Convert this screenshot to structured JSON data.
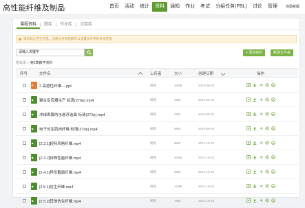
{
  "header": {
    "course_title": "高性能纤维及制品",
    "course_subtitle": "课程门户",
    "nav": [
      "首页",
      "活动",
      "统计",
      "资料",
      "通知",
      "作业",
      "考试",
      "分组任务(PBL)",
      "讨论",
      "管理"
    ],
    "nav_active": "资料",
    "right_label": "体验新版"
  },
  "tabs": [
    "课程资料",
    "题库",
    "作业库",
    "试卷库"
  ],
  "notice": "资料默认学生可见，创建文件夹后即可以设置文件夹的共享范围",
  "search": {
    "placeholder": "请输入关键字"
  },
  "buttons": {
    "add_resource": "+ 添加资料",
    "new_folder": "新建文件夹"
  },
  "breadcrumb": {
    "root": "根目录",
    "sep": ">",
    "current": "第2章教学资料"
  },
  "table": {
    "headers": {
      "index": "序号",
      "name": "文件名",
      "uploader": "上传者",
      "size": "大小",
      "created": "创建日期",
      "ops": "操作"
    },
    "rows": [
      {
        "type": "ppt",
        "name": "2 高感性纤维---.ppt",
        "uploader": "杨恂",
        "size": "24MB",
        "date": "2019-09-05"
      },
      {
        "type": "mp4",
        "name": "聚合反应器生产 标清(270p).mp4",
        "uploader": "杨恂",
        "size": "4MB",
        "date": "2019-09-05"
      },
      {
        "type": "mp4",
        "name": "冲绿表膜的水悬浮选面 标清(270p).mp4",
        "uploader": "杨恂",
        "size": "2MB",
        "date": "2019-09-05"
      },
      {
        "type": "mp4",
        "name": "电子仿生肌肉纤维 标清(270p).mp4",
        "uploader": "杨恂",
        "size": "5MB",
        "date": "2019-09-05"
      },
      {
        "type": "mp4",
        "name": "[2.3.1]超特风格纤维.mp4",
        "uploader": "杨恂",
        "size": "9MB",
        "date": "2021-10-25"
      },
      {
        "type": "mp4",
        "name": "[2.3.2]特殊性能纤维.mp4",
        "uploader": "杨恂",
        "size": "20MB",
        "date": "2021-10-25"
      },
      {
        "type": "mp4",
        "name": "[2.4.1]异形截面纤维.mp4",
        "uploader": "杨恂",
        "size": "8MB",
        "date": "2021-10-25"
      },
      {
        "type": "mp4",
        "name": "[2.5.1]仿生纤维.mp4",
        "uploader": "杨恂",
        "size": "11MB",
        "date": "2021-10-25"
      },
      {
        "type": "mp4",
        "name": "[2.5.2]其他仿生纤维.mp4",
        "uploader": "杨恂",
        "size": "7MB",
        "date": "2021-10-25"
      }
    ]
  },
  "colors": {
    "accent": "#5b9b2f",
    "button": "#7bb244",
    "notice_bg": "#fdf3df"
  }
}
